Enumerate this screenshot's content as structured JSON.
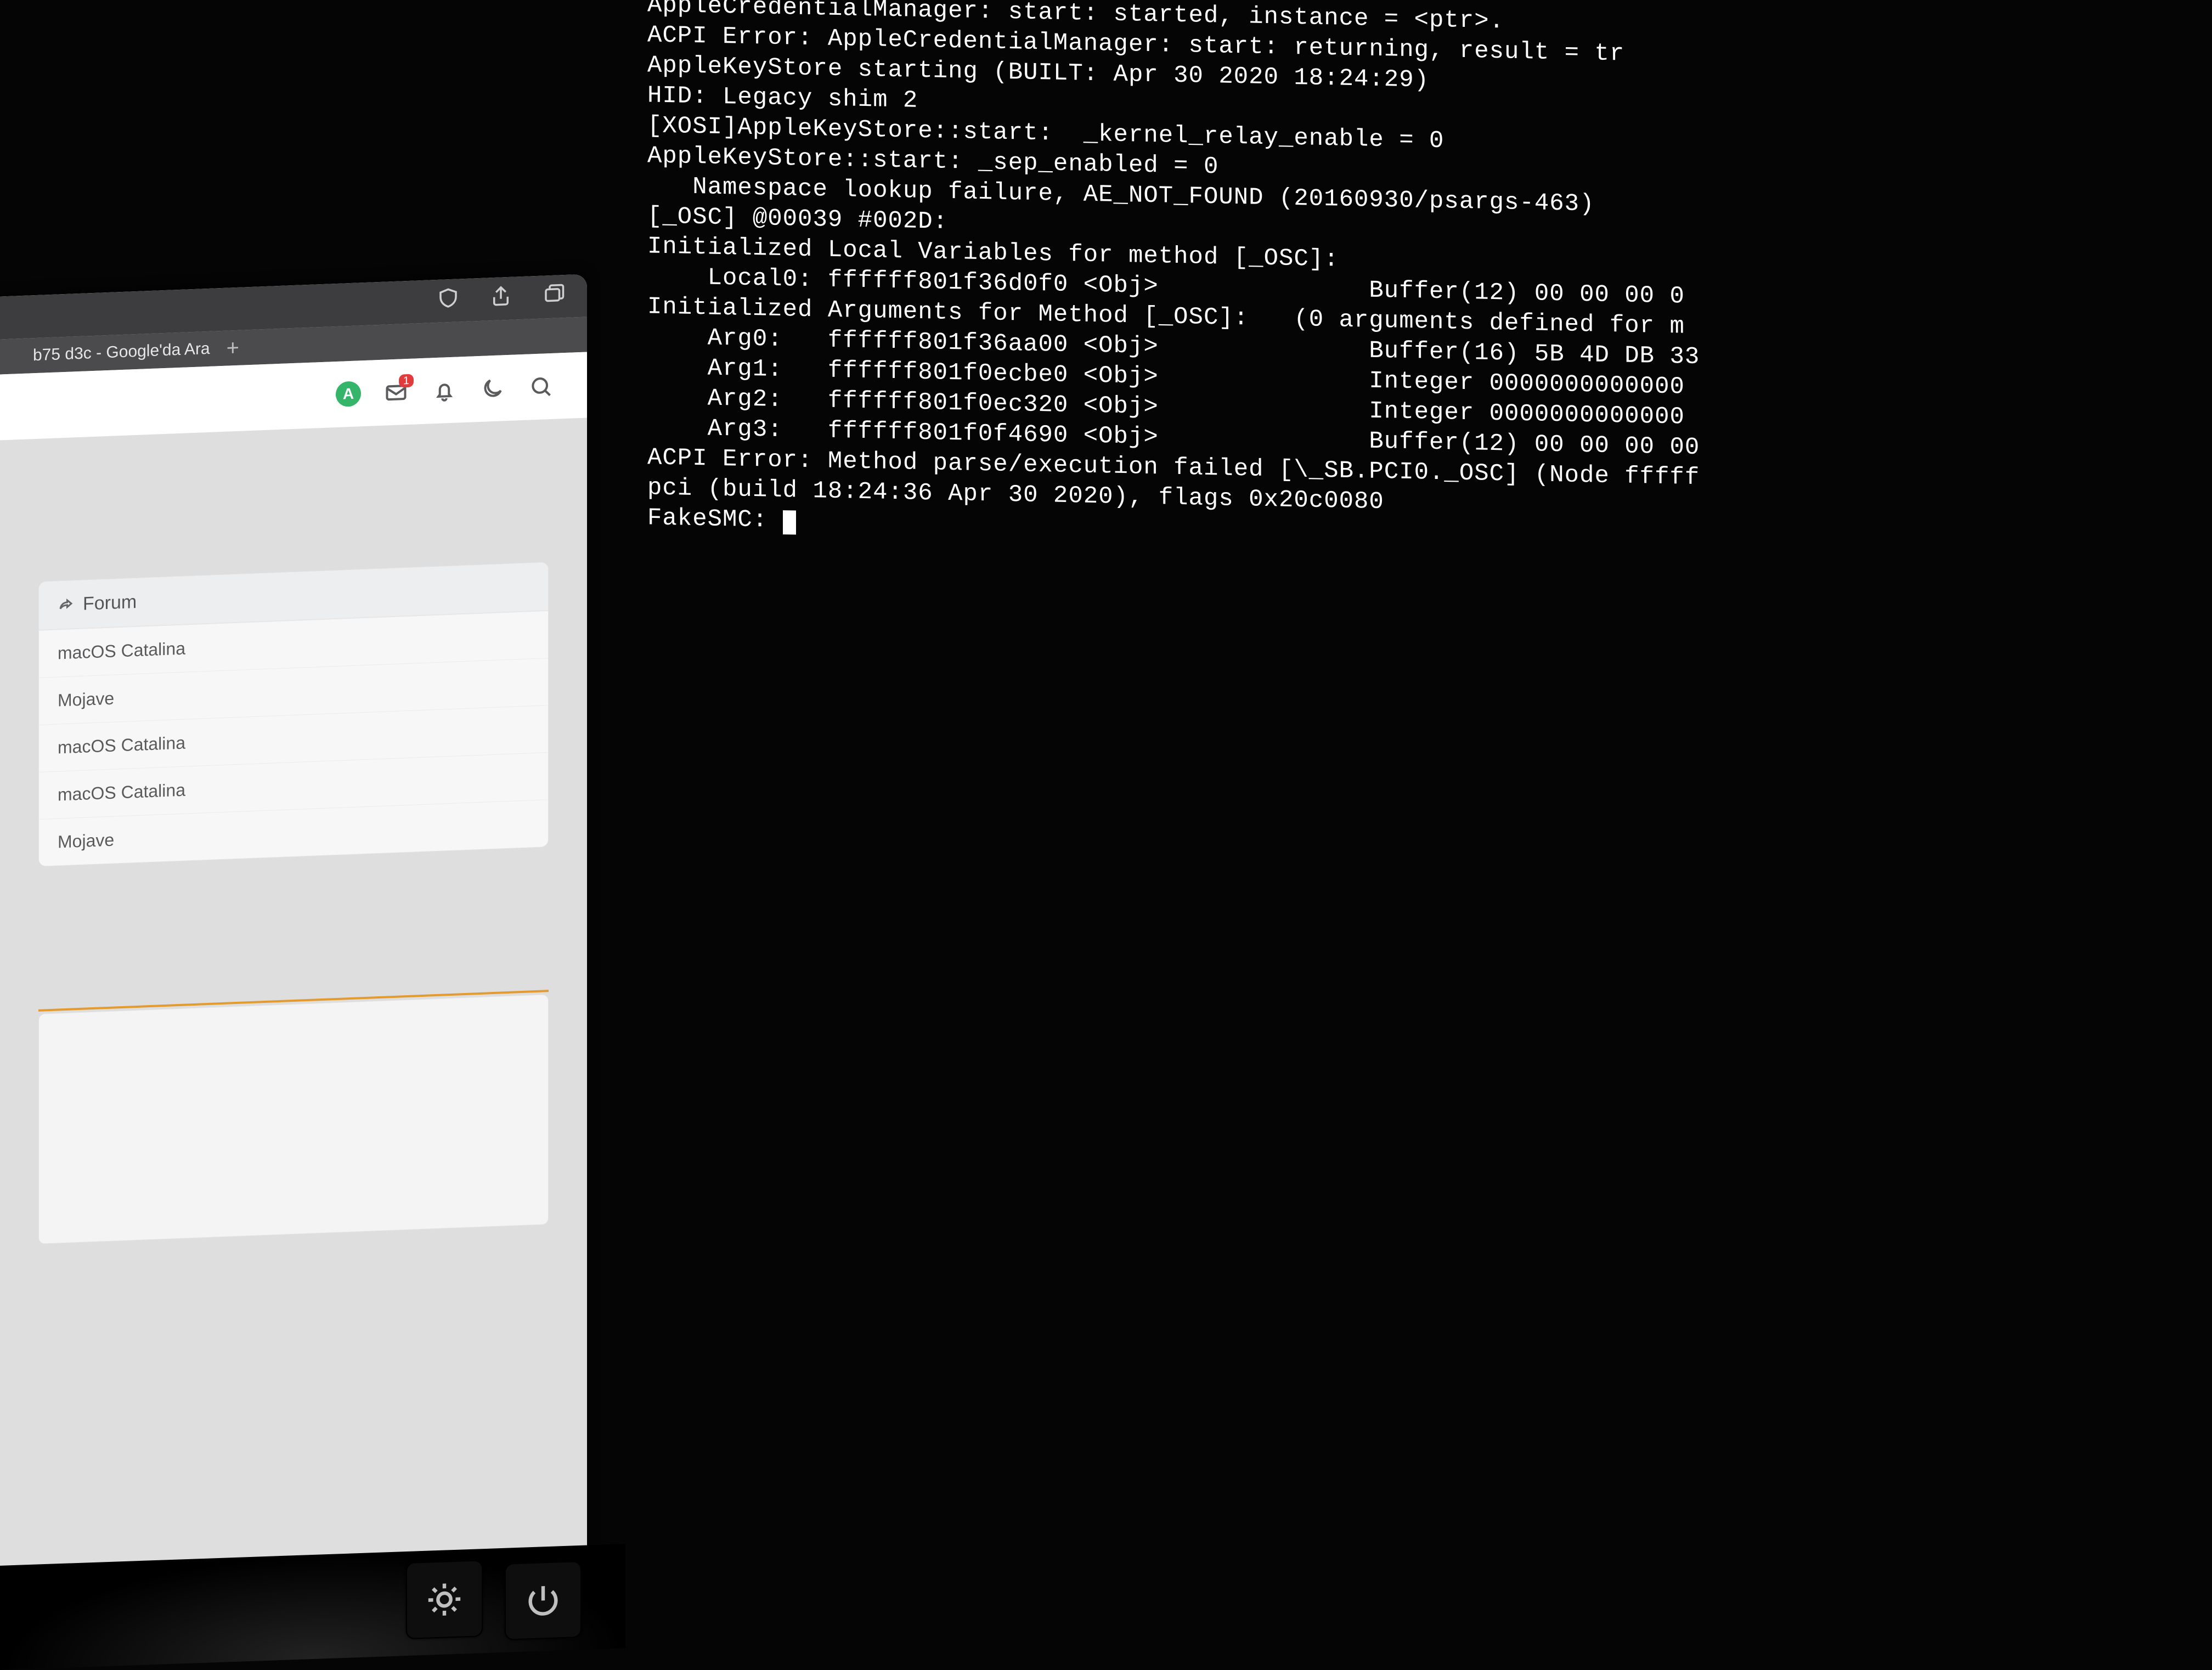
{
  "console_lines": [
    "AppleCredentialManager: start: started, instance = <ptr>.",
    "ACPI Error: AppleCredentialManager: start: returning, result = tr",
    "AppleKeyStore starting (BUILT: Apr 30 2020 18:24:29)",
    "HID: Legacy shim 2",
    "[XOSI]AppleKeyStore::start:  _kernel_relay_enable = 0",
    "AppleKeyStore::start: _sep_enabled = 0",
    "   Namespace lookup failure, AE_NOT_FOUND (20160930/psargs-463)",
    "[_OSC] @00039 #002D:",
    "",
    "Initialized Local Variables for method [_OSC]:",
    "    Local0: ffffff801f36d0f0 <Obj>              Buffer(12) 00 00 00 0",
    "",
    "Initialized Arguments for Method [_OSC]:   (0 arguments defined for m",
    "    Arg0:   ffffff801f36aa00 <Obj>              Buffer(16) 5B 4D DB 33",
    "    Arg1:   ffffff801f0ecbe0 <Obj>              Integer 0000000000000",
    "    Arg2:   ffffff801f0ec320 <Obj>              Integer 0000000000000",
    "    Arg3:   ffffff801f0f4690 <Obj>              Buffer(12) 00 00 00 00",
    "",
    "ACPI Error: Method parse/execution failed [\\_SB.PCI0._OSC] (Node fffff",
    "pci (build 18:24:36 Apr 30 2020), flags 0x20c0080",
    "FakeSMC: "
  ],
  "browser": {
    "tab_title": "b75 d3c - Google'da Ara",
    "avatar_letter": "A",
    "mail_badge": "1",
    "panel_header": "Forum",
    "panel_rows": [
      "macOS Catalina",
      "Mojave",
      "macOS Catalina",
      "macOS Catalina",
      "Mojave"
    ]
  }
}
